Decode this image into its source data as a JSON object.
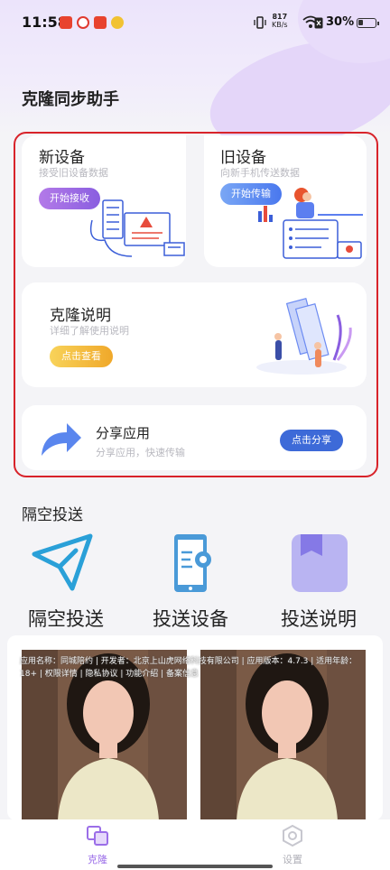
{
  "status_bar": {
    "time": "11:58",
    "net_speed_value": "817",
    "net_speed_unit": "KB/s",
    "battery": "30%"
  },
  "app": {
    "title": "克隆同步助手"
  },
  "cards": {
    "new_device": {
      "title": "新设备",
      "subtitle": "接受旧设备数据",
      "button": "开始接收"
    },
    "old_device": {
      "title": "旧设备",
      "subtitle": "向新手机传送数据",
      "button": "开始传输"
    },
    "clone_guide": {
      "title": "克隆说明",
      "subtitle": "详细了解使用说明",
      "button": "点击查看"
    },
    "share_app": {
      "title": "分享应用",
      "subtitle": "分享应用，快速传输",
      "button": "点击分享"
    }
  },
  "airdrop": {
    "section_title": "隔空投送",
    "items": [
      {
        "label": "隔空投送",
        "icon": "paper-plane-icon"
      },
      {
        "label": "投送设备",
        "icon": "phone-settings-icon"
      },
      {
        "label": "投送说明",
        "icon": "book-icon"
      }
    ]
  },
  "ad": {
    "meta": "应用名称：同城陪约 | 开发者：北京上山虎网络科技有限公司 | 应用版本：4.7.3 | 适用年龄：18+ | 权限详情 | 隐私协议 | 功能介绍 | 备案信息"
  },
  "tab_bar": {
    "tabs": [
      {
        "label": "克隆",
        "icon": "clone-icon",
        "active": true
      },
      {
        "label": "设置",
        "icon": "settings-icon",
        "active": false
      }
    ]
  },
  "colors": {
    "accent_purple": "#9b6ee8",
    "share_blue": "#4a78ee",
    "guide_yellow": "#f5b630",
    "highlight_red": "#d8232a"
  }
}
